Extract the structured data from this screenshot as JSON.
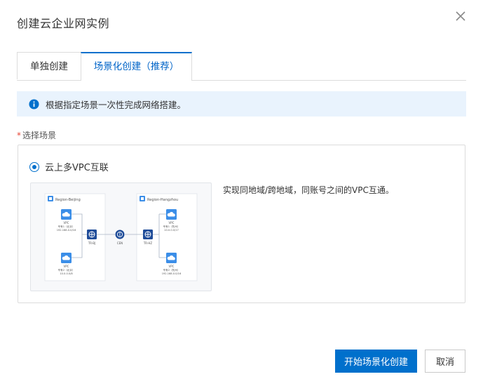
{
  "dialog": {
    "title": "创建云企业网实例"
  },
  "tabs": [
    {
      "label": "单独创建",
      "active": false
    },
    {
      "label": "场景化创建（推荐）",
      "active": true
    }
  ],
  "notice": {
    "text": "根据指定场景一次性完成网络搭建。"
  },
  "scene_field": {
    "required_mark": "*",
    "label": "选择场景"
  },
  "scene": {
    "option_label": "云上多VPC互联",
    "selected": true,
    "description": "实现同地域/跨地域，同账号之间的VPC互通。"
  },
  "diagram": {
    "region_left": "Region-Beijing",
    "region_right": "Region-Hangzhou",
    "left_vpc_top": {
      "name": "VPC",
      "line1": "专有1（北京）",
      "line2": "192.168.0.0/16"
    },
    "left_vpc_bottom": {
      "name": "VPC",
      "line1": "专有2（北京）",
      "line2": "10.0.0.0/8"
    },
    "right_vpc_top": {
      "name": "VPC",
      "line1": "专有1（杭州）",
      "line2": "10.0.0.0/17"
    },
    "right_vpc_bottom": {
      "name": "VPC",
      "line1": "专有2（杭州）",
      "line2": "192.168.0.0/16"
    },
    "tr_left": "TR-BJ",
    "cen": "CEN",
    "tr_right": "TR-HZ"
  },
  "actions": {
    "primary": "开始场景化创建",
    "cancel": "取消"
  },
  "colors": {
    "primary": "#0070cc",
    "notice_bg": "#e9f3fd",
    "required": "#e84738",
    "node_blue": "#1f4c99",
    "vpc_blue": "#3b8ee8"
  }
}
